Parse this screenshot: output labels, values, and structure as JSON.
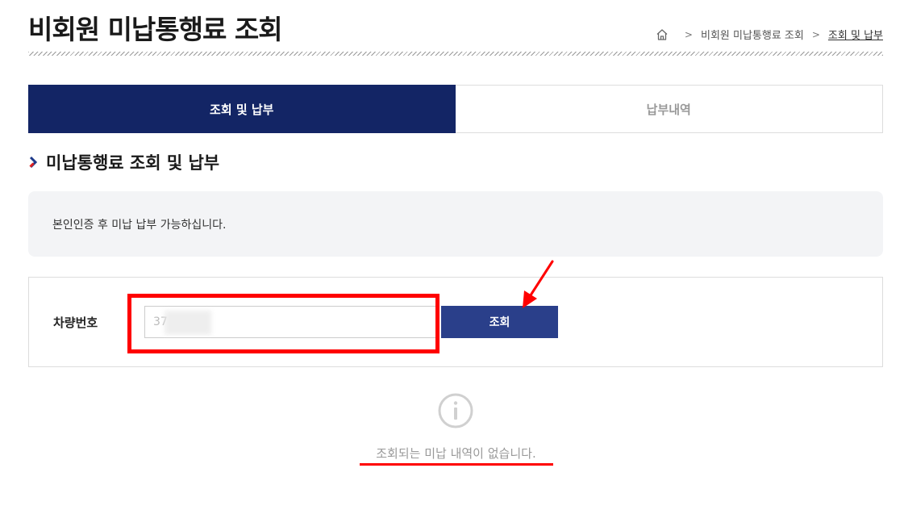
{
  "header": {
    "title": "비회원 미납통행료 조회",
    "breadcrumb": {
      "home_icon": "home-icon",
      "items": [
        "비회원 미납통행료 조회",
        "조회 및 납부"
      ]
    }
  },
  "tabs": [
    {
      "label": "조회 및 납부",
      "active": true
    },
    {
      "label": "납부내역",
      "active": false
    }
  ],
  "section": {
    "title": "미납통행료 조회 및 납부",
    "info_text": "본인인증 후 미납 납부 가능하십니다."
  },
  "form": {
    "vehicle_label": "차량번호",
    "vehicle_value": "37",
    "search_button": "조회"
  },
  "result": {
    "icon": "info-icon",
    "empty_message": "조회되는 미납 내역이 없습니다."
  },
  "colors": {
    "primary": "#132565",
    "button": "#2a3f8a",
    "annotation": "#ff0000",
    "muted_text": "#999999",
    "info_bg": "#f3f4f6"
  }
}
